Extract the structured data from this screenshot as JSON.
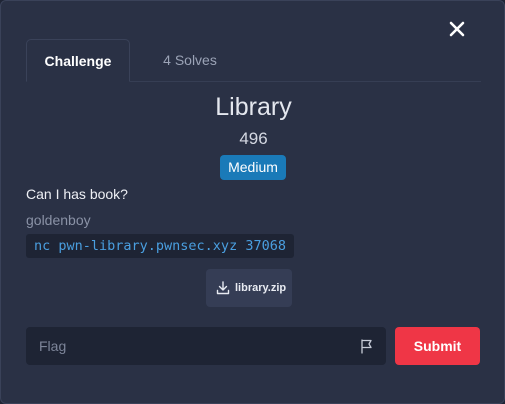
{
  "tabs": [
    {
      "label": "Challenge",
      "active": true
    },
    {
      "label": "4 Solves",
      "active": false
    }
  ],
  "challenge": {
    "name": "Library",
    "points": "496",
    "difficulty": "Medium",
    "description": "Can I has book?",
    "author": "goldenboy",
    "connection": "nc pwn-library.pwnsec.xyz 37068"
  },
  "files": [
    {
      "name": "library.zip"
    }
  ],
  "form": {
    "flag_placeholder": "Flag",
    "submit_label": "Submit"
  },
  "colors": {
    "modal_bg": "#2a3145",
    "badge": "#1a7ab8",
    "submit": "#ef3646",
    "code_text": "#4a9fe0"
  },
  "icons": {
    "close": "close-icon",
    "download": "download-icon",
    "flag": "flag-icon"
  }
}
